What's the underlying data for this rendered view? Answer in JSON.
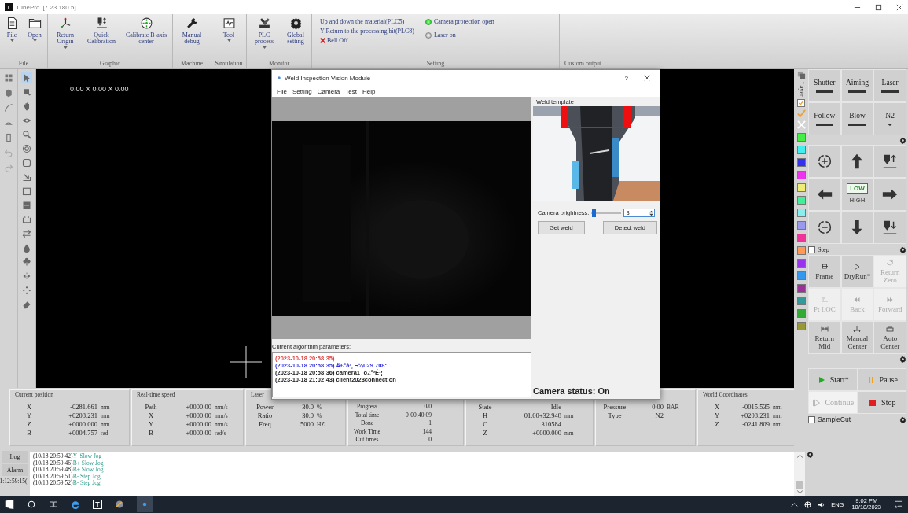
{
  "window": {
    "logo_letter": "T",
    "app_name": "TubePro",
    "version": "[7.23.180.5]"
  },
  "ribbon": [
    {
      "label": "File",
      "buttons": [
        {
          "label": "File",
          "dropdown": true
        },
        {
          "label": "Open",
          "dropdown": true
        }
      ]
    },
    {
      "label": "Graphic",
      "buttons": [
        {
          "label": "Return Origin",
          "dropdown": true
        },
        {
          "label": "Quick Calibration",
          "dropdown": false
        },
        {
          "label": "Calibrate B-axis center",
          "dropdown": false
        }
      ]
    },
    {
      "label": "Machine",
      "buttons": [
        {
          "label": "Manual debug",
          "dropdown": false
        }
      ]
    },
    {
      "label": "Simulation",
      "buttons": [
        {
          "label": "Tool",
          "dropdown": true
        }
      ]
    },
    {
      "label": "Monitor",
      "buttons": [
        {
          "label": "PLC process",
          "dropdown": true
        },
        {
          "label": "Global setting",
          "dropdown": false
        }
      ]
    }
  ],
  "setting_group": {
    "label": "Setting",
    "items": [
      {
        "label": "Up and down the material(PLC5)",
        "kind": "text"
      },
      {
        "label": "Y Return to the processing bit(PLC8)",
        "kind": "text"
      },
      {
        "label": "Bell Off",
        "kind": "bell"
      }
    ],
    "indicators": [
      {
        "label": "Camera protection open",
        "on": true
      },
      {
        "label": "Laser on",
        "on": false
      }
    ]
  },
  "custom_output": {
    "label": "Custom output"
  },
  "tool_palette": [
    {
      "selected": true
    },
    {
      "selected": false
    },
    {
      "selected": false
    },
    {
      "selected": false
    },
    {
      "selected": false
    },
    {
      "selected": false
    },
    {
      "selected": false
    },
    {
      "selected": false
    },
    {
      "selected": false
    },
    {
      "selected": false
    },
    {
      "selected": false
    },
    {
      "selected": false
    },
    {
      "selected": false
    },
    {
      "selected": false
    },
    {
      "selected": false
    },
    {
      "selected": false
    },
    {
      "selected": false
    }
  ],
  "canvas": {
    "dimensions": "0.00 X 0.00 X 0.00"
  },
  "dialog": {
    "title": "Weld Inspection Vision Module",
    "help": "?",
    "menu": [
      "File",
      "Setting",
      "Camera",
      "Test",
      "Help"
    ],
    "params_label": "Current algorithm parameters:",
    "log": [
      {
        "text": "(2023-10-18 20:58:35)",
        "color": "#e04040"
      },
      {
        "text": "(2023-10-18 20:58:35) Ä£°å³¸ ¬¼û29.708:",
        "color": "#3030e0"
      },
      {
        "text": "(2023-10-18 20:58:36) camera1 ´ò¿ª³É¹¦",
        "color": "#222222"
      },
      {
        "text": "(2023-10-18 21:02:43) client2028connection",
        "color": "#222222"
      }
    ],
    "template_label": "Weld template",
    "brightness": {
      "label": "Camera brightness:",
      "level": 0.05,
      "value": "3"
    },
    "buttons": [
      "Get weld",
      "Detect weld"
    ],
    "camera_status": "Camera status: On"
  },
  "layers": {
    "label": "Layer",
    "checked": true,
    "colors": [
      {
        "color": "#44ee44"
      },
      {
        "color": "#44eeee"
      },
      {
        "color": "#3333ee"
      },
      {
        "color": "#ee33ee"
      },
      {
        "color": "#eeee77"
      },
      {
        "color": "#44ee99"
      },
      {
        "color": "#88eeee"
      },
      {
        "color": "#9999ee"
      },
      {
        "color": "#ee3399"
      },
      {
        "color": "#ff9955"
      },
      {
        "color": "#9933ee"
      },
      {
        "color": "#3399ee"
      },
      {
        "color": "#993399"
      },
      {
        "color": "#339999"
      },
      {
        "color": "#33aa33"
      },
      {
        "color": "#999933"
      }
    ]
  },
  "outputs": [
    {
      "label": "Shutter",
      "kind": "toggle"
    },
    {
      "label": "Aiming",
      "kind": "toggle"
    },
    {
      "label": "Laser",
      "kind": "toggle"
    },
    {
      "label": "Follow",
      "kind": "toggle"
    },
    {
      "label": "Blow",
      "kind": "toggle"
    },
    {
      "label": "N2",
      "kind": "menu"
    }
  ],
  "jog": {
    "speeds": [
      {
        "label": "LOW",
        "selected": true
      },
      {
        "label": "HIGH",
        "selected": false
      }
    ],
    "step": {
      "label": "Step",
      "checked": false
    }
  },
  "actions": [
    {
      "label": "Frame",
      "disabled": false
    },
    {
      "label": "DryRun*",
      "disabled": false
    },
    {
      "label": "Return Zero",
      "disabled": true
    },
    {
      "label": "Pt LOC",
      "disabled": true
    },
    {
      "label": "Back",
      "disabled": true
    },
    {
      "label": "Forward",
      "disabled": true
    },
    {
      "label": "Return Mid",
      "disabled": false
    },
    {
      "label": "Manual Center",
      "disabled": false
    },
    {
      "label": "Auto Center",
      "disabled": false
    }
  ],
  "run": [
    {
      "label": "Start*",
      "disabled": false
    },
    {
      "label": "Pause",
      "disabled": false
    },
    {
      "label": "Continue",
      "disabled": true
    },
    {
      "label": "Stop",
      "disabled": false
    }
  ],
  "sample_cut": {
    "label": "SampleCut",
    "checked": false
  },
  "status": [
    {
      "title": "Current position",
      "rows": [
        {
          "name": "X",
          "value": "-0281.661",
          "unit": "mm"
        },
        {
          "name": "Y",
          "value": "+0208.231",
          "unit": "mm"
        },
        {
          "name": "Z",
          "value": "+0000.000",
          "unit": "mm"
        },
        {
          "name": "B",
          "value": "+0004.757",
          "unit": "rad"
        }
      ]
    },
    {
      "title": "Real-time speed",
      "rows": [
        {
          "name": "Path",
          "value": "+0000.00",
          "unit": "mm/s"
        },
        {
          "name": "X",
          "value": "+0000.00",
          "unit": "mm/s"
        },
        {
          "name": "Y",
          "value": "+0000.00",
          "unit": "mm/s"
        },
        {
          "name": "B",
          "value": "+0000.00",
          "unit": "rad/s"
        }
      ]
    },
    {
      "title": "Laser",
      "rows": [
        {
          "name": "Power",
          "value": "30.0",
          "unit": "%"
        },
        {
          "name": "Ratio",
          "value": "30.0",
          "unit": "%"
        },
        {
          "name": "Freq",
          "value": "5000",
          "unit": "HZ"
        }
      ]
    },
    {
      "rows": [
        {
          "name": "Progress",
          "value": "0/0"
        },
        {
          "name": "Total time",
          "value": "0-00:40:09"
        },
        {
          "name": "Done",
          "value": "1"
        },
        {
          "name": "Work Time",
          "value": "144"
        },
        {
          "name": "Cut times",
          "value": "0"
        }
      ]
    },
    {
      "rows": [
        {
          "name": "State",
          "value": "Idle"
        },
        {
          "name": "H",
          "value": "01.00+32.948",
          "unit": "mm"
        },
        {
          "name": "C",
          "value": "310584"
        },
        {
          "name": "Z",
          "value": "+0000.000",
          "unit": "mm"
        }
      ]
    },
    {
      "rows": [
        {
          "name": "Pressure",
          "value": "0.00",
          "unit": "BAR"
        },
        {
          "name": "Type",
          "value": "N2"
        }
      ]
    },
    {
      "title": "World Coordinates",
      "rows": [
        {
          "name": "X",
          "value": "-0015.535",
          "unit": "mm"
        },
        {
          "name": "Y",
          "value": "+0208.231",
          "unit": "mm"
        },
        {
          "name": "Z",
          "value": "-0241.809",
          "unit": "mm"
        }
      ]
    }
  ],
  "log": {
    "tabs": [
      "Log",
      "Alarm"
    ],
    "time": "1:12:59:15(",
    "lines": [
      {
        "time": "(10/18 20:59:42)",
        "message": "Y- Slow Jog"
      },
      {
        "time": "(10/18 20:59:46)",
        "message": "B+ Slow Jog"
      },
      {
        "time": "(10/18 20:59:48)",
        "message": "B+ Slow Jog"
      },
      {
        "time": "(10/18 20:59:51)",
        "message": "B- Step Jog"
      },
      {
        "time": "(10/18 20:59:52)",
        "message": "B- Step Jog"
      }
    ]
  },
  "taskbar": {
    "app_letter": "T",
    "language": "ENG",
    "time": "9:02 PM",
    "date": "10/18/2023"
  }
}
